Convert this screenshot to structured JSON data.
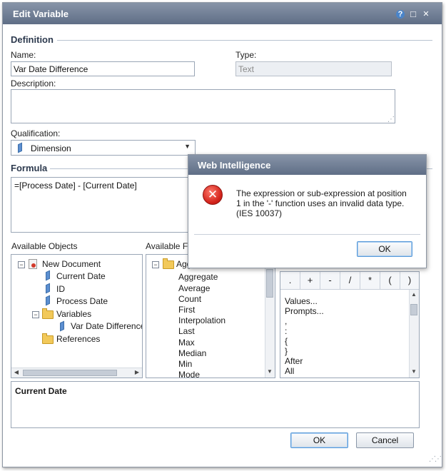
{
  "window": {
    "title": "Edit Variable",
    "controls": {
      "help": "?",
      "maximize": "□",
      "close": "✕"
    }
  },
  "definition": {
    "section_label": "Definition",
    "name_label": "Name:",
    "name_value": "Var Date Difference",
    "type_label": "Type:",
    "type_value": "Text",
    "description_label": "Description:",
    "description_value": "",
    "qualification_label": "Qualification:",
    "qualification_value": "Dimension"
  },
  "formula": {
    "section_label": "Formula",
    "value": "=[Process Date] - [Current Date]"
  },
  "available_objects": {
    "label": "Available Objects",
    "items": [
      {
        "label": "New Document"
      },
      {
        "label": "Current Date"
      },
      {
        "label": "ID"
      },
      {
        "label": "Process Date"
      },
      {
        "label": "Variables"
      },
      {
        "label": "Var Date Difference"
      },
      {
        "label": "References"
      }
    ]
  },
  "available_functions": {
    "label": "Available Fu",
    "folder_label": "Agg",
    "items": [
      "Aggregate",
      "Average",
      "Count",
      "First",
      "Interpolation",
      "Last",
      "Max",
      "Median",
      "Min",
      "Mode"
    ]
  },
  "operators": {
    "buttons": [
      ".",
      "+",
      "-",
      "/",
      "*",
      "(",
      ")"
    ],
    "items": [
      "Values...",
      "Prompts...",
      ",",
      ":",
      "{",
      "}",
      "After",
      "All"
    ]
  },
  "description_panel": {
    "title": "Current Date"
  },
  "footer": {
    "ok_label": "OK",
    "cancel_label": "Cancel"
  },
  "error_dialog": {
    "title": "Web Intelligence",
    "icon": "error-icon",
    "message": "The expression or sub-expression at position 1 in the '-' function uses an invalid data type. (IES 10037)",
    "ok_label": "OK"
  }
}
